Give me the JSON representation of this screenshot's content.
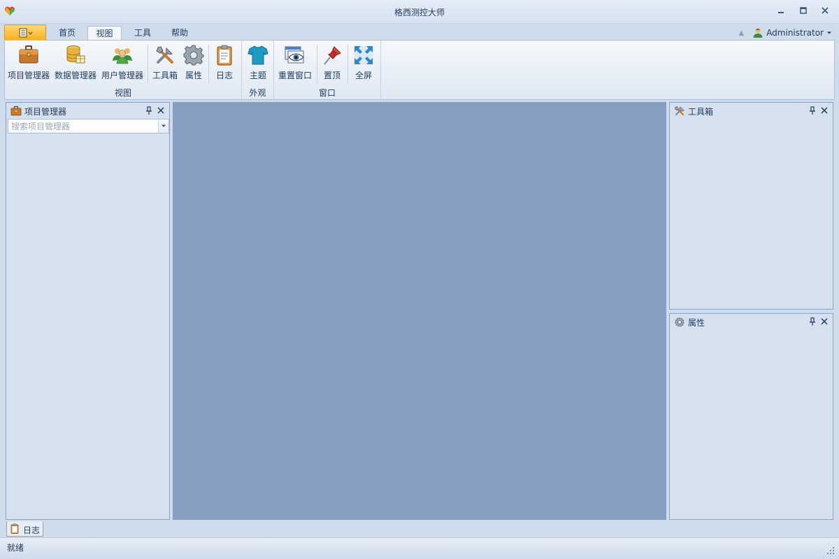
{
  "window": {
    "title": "格西测控大师",
    "logo_icon": "heart-logo-icon",
    "minimize_icon": "minimize-icon",
    "restore_icon": "restore-icon",
    "close_icon": "close-icon"
  },
  "tabs": {
    "app_menu_icon": "document-menu-icon",
    "items": [
      {
        "label": "首页",
        "active": false
      },
      {
        "label": "视图",
        "active": true
      },
      {
        "label": "工具",
        "active": false
      },
      {
        "label": "帮助",
        "active": false
      }
    ]
  },
  "user": {
    "name": "Administrator",
    "icon": "user-icon"
  },
  "ribbon": {
    "groups": [
      {
        "label": "视图",
        "buttons": [
          {
            "label": "项目管理器",
            "icon": "briefcase-icon"
          },
          {
            "label": "数据管理器",
            "icon": "database-icon"
          },
          {
            "label": "用户管理器",
            "icon": "users-icon"
          },
          {
            "label": "工具箱",
            "icon": "tools-icon"
          },
          {
            "label": "属性",
            "icon": "gear-icon"
          },
          {
            "label": "日志",
            "icon": "clipboard-icon"
          }
        ]
      },
      {
        "label": "外观",
        "buttons": [
          {
            "label": "主题",
            "icon": "tshirt-icon"
          }
        ]
      },
      {
        "label": "窗口",
        "buttons": [
          {
            "label": "重置窗口",
            "icon": "window-eye-icon"
          },
          {
            "label": "置顶",
            "icon": "pushpin-icon"
          },
          {
            "label": "全屏",
            "icon": "fullscreen-icon"
          }
        ]
      }
    ]
  },
  "panels": {
    "project_manager": {
      "title": "项目管理器",
      "search_placeholder": "搜索项目管理器"
    },
    "toolbox": {
      "title": "工具箱"
    },
    "properties": {
      "title": "属性"
    }
  },
  "dock": {
    "log_tab": "日志"
  },
  "status": {
    "text": "就绪"
  },
  "colors": {
    "workspace": "#869fc0",
    "panel_bg": "#d6e1ef",
    "app_menu_accent": "#f7b21a",
    "text": "#1e395b"
  }
}
